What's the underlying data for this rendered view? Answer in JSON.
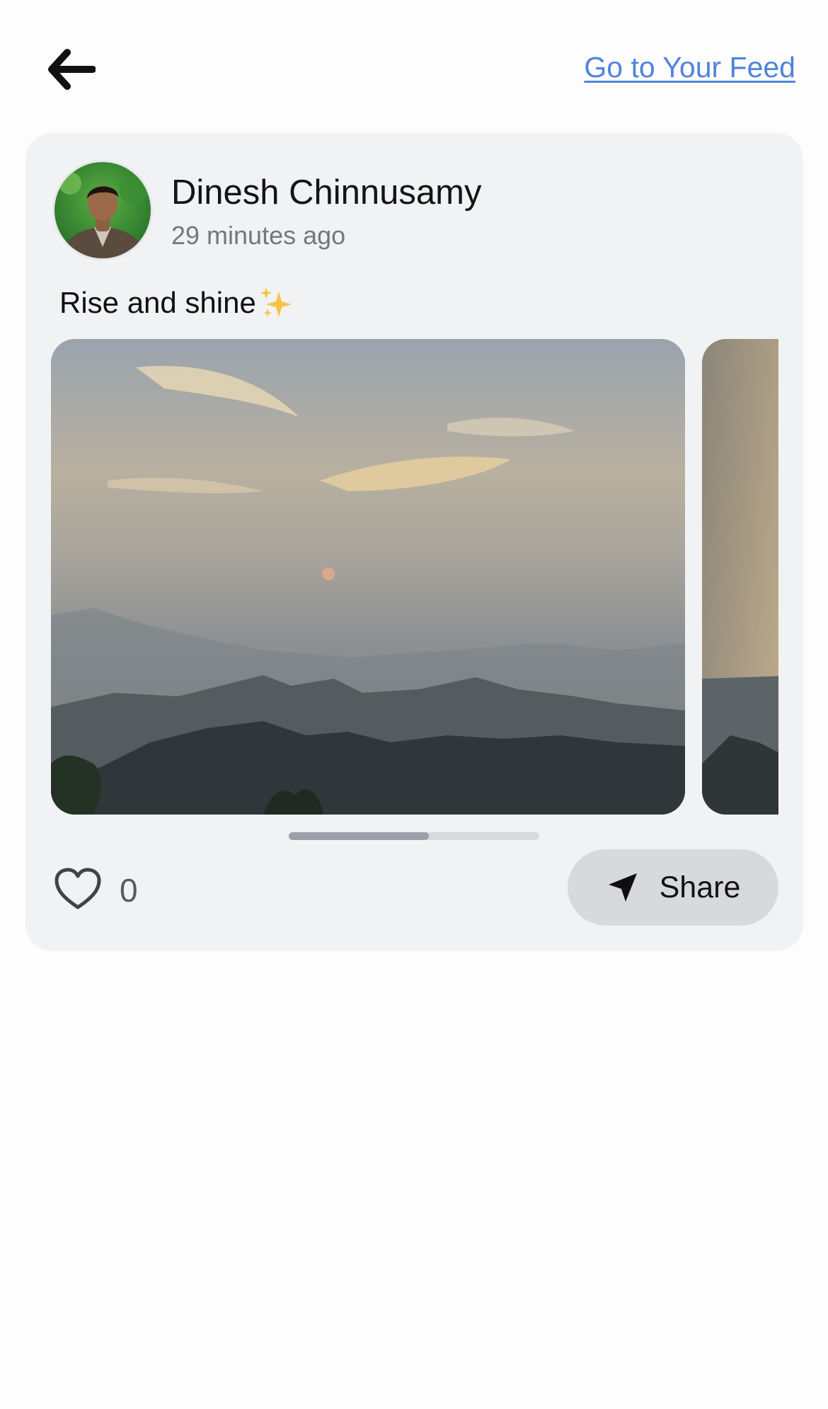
{
  "header": {
    "back_icon": "arrow-left-icon",
    "feed_link": "Go to Your Feed"
  },
  "post": {
    "author_name": "Dinesh Chinnusamy",
    "timestamp": "29 minutes ago",
    "caption": "Rise and shine",
    "caption_emoji": "sparkles-icon",
    "images_icon": "mountain-sunrise-photo",
    "carousel_progress": 0.56,
    "likes": "0",
    "share_label": "Share"
  },
  "colors": {
    "link": "#4f84dc",
    "card_bg": "#f1f2f4",
    "button_bg": "#d7d9dd"
  }
}
